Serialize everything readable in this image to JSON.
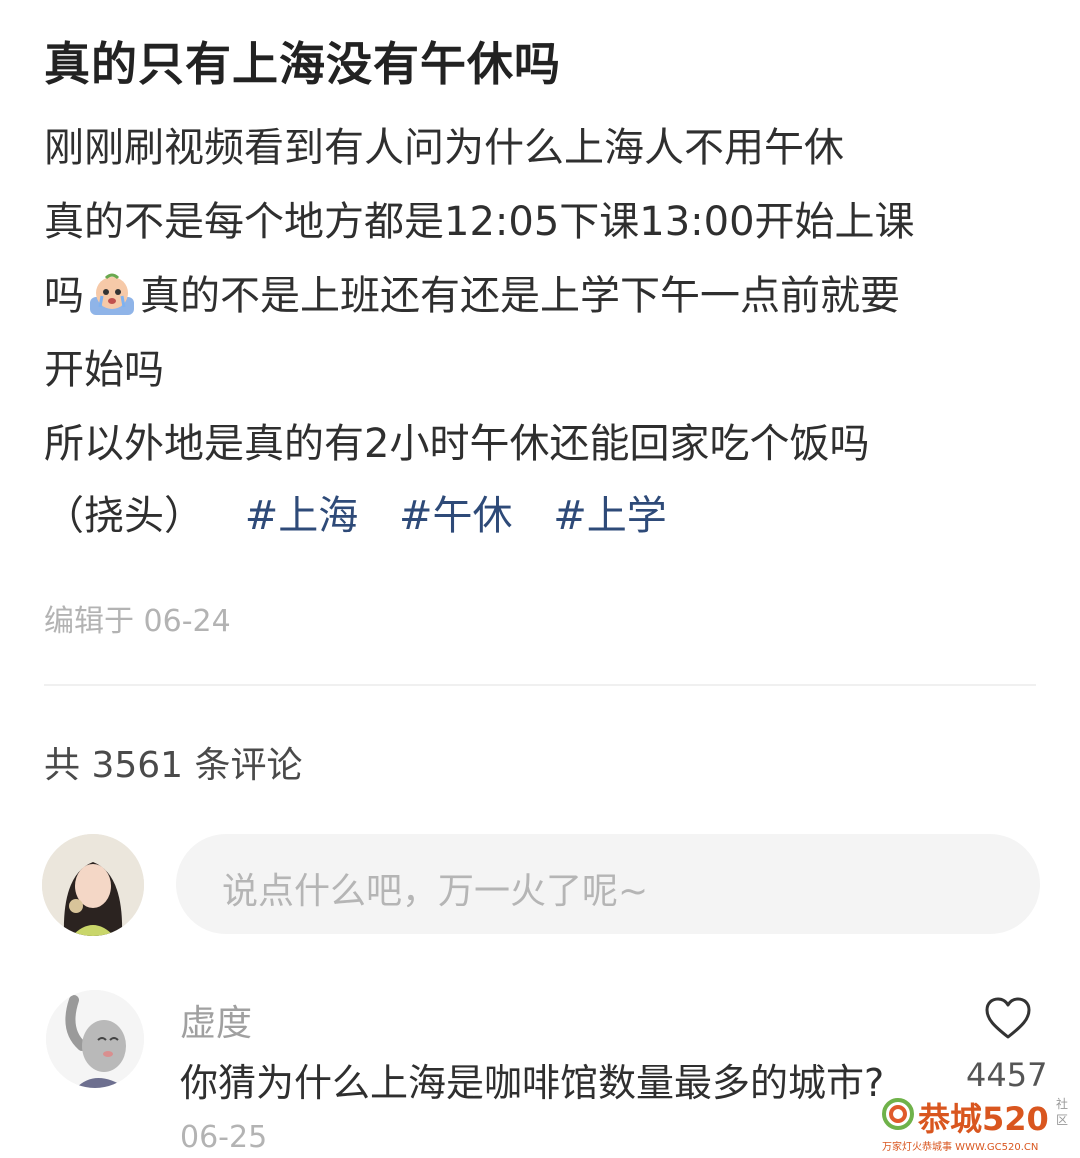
{
  "post": {
    "title": "真的只有上海没有午休吗",
    "lines": [
      "刚刚刷视频看到有人问为什么上海人不用午休",
      "真的不是每个地方都是12:05下课13:00开始上课",
      "真的不是上班还有还是上学下午一点前就要",
      "开始吗",
      "所以外地是真的有2小时午休还能回家吃个饭吗",
      "（挠头）"
    ],
    "line3_prefix": "吗",
    "tags": [
      "#上海",
      "#午休",
      "#上学"
    ],
    "edited": "编辑于 06-24"
  },
  "comments": {
    "count_label": "共 3561 条评论",
    "input_placeholder": "说点什么吧，万一火了呢~",
    "items": [
      {
        "name": "虚度",
        "text": "你猜为什么上海是咖啡馆数量最多的城市?",
        "date": "06-25",
        "likes": "4457"
      }
    ]
  },
  "watermark": {
    "main": "恭城520",
    "side": "社区",
    "sub": "万家灯火恭城事 WWW.GC520.CN"
  },
  "colors": {
    "tag": "#2e4a78",
    "muted": "#b3b3b3",
    "input_bg": "#f4f4f4"
  },
  "icons": {
    "emoji": "crying-face-emoji",
    "like": "heart-icon"
  }
}
